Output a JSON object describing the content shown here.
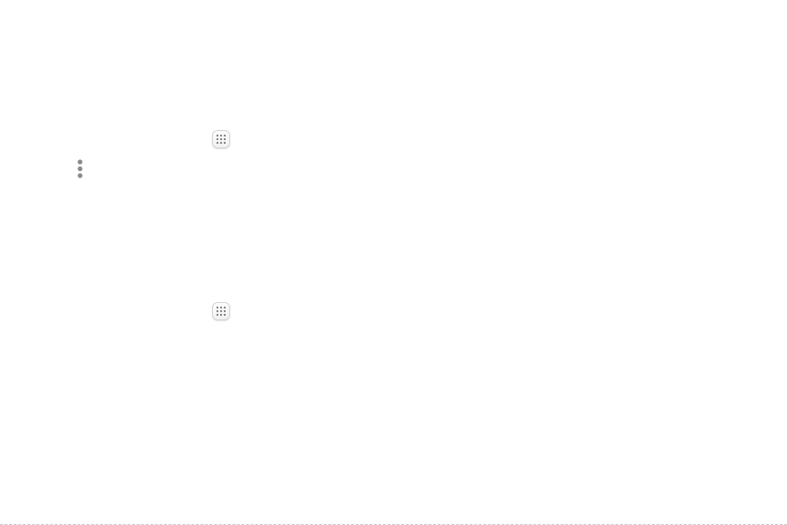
{
  "icons": {
    "apps_icon": "apps-grid-icon",
    "more_options_icon": "more-options-vertical-icon"
  },
  "colors": {
    "background": "#ffffff",
    "icon_dots": "#8a8a8a",
    "button_border": "#d4d4d4"
  }
}
